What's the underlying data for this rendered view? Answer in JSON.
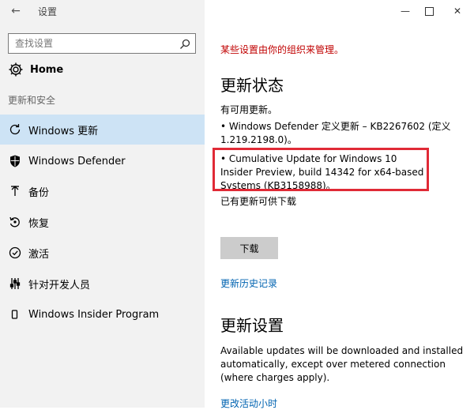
{
  "window": {
    "title": "设置",
    "back_glyph": "←",
    "minimize_glyph": "—",
    "close_glyph": "✕"
  },
  "search": {
    "placeholder": "查找设置"
  },
  "home": {
    "label": "Home"
  },
  "sidebar": {
    "section_label": "更新和安全",
    "items": [
      {
        "label": "Windows 更新",
        "icon": "refresh-icon",
        "active": true
      },
      {
        "label": "Windows Defender",
        "icon": "shield-icon",
        "active": false
      },
      {
        "label": "备份",
        "icon": "backup-arrow-icon",
        "active": false
      },
      {
        "label": "恢复",
        "icon": "recovery-icon",
        "active": false
      },
      {
        "label": "激活",
        "icon": "check-circle-icon",
        "active": false
      },
      {
        "label": "针对开发人员",
        "icon": "developer-sliders-icon",
        "active": false
      },
      {
        "label": "Windows Insider Program",
        "icon": "insider-icon",
        "active": false
      }
    ]
  },
  "main": {
    "managed_notice": "某些设置由你的组织来管理。",
    "update_status_heading": "更新状态",
    "available_text": "有可用更新。",
    "updates": [
      "• Windows Defender 定义更新 – KB2267602 (定义 1.219.2198.0)。",
      "• Cumulative Update for Windows 10 Insider Preview, build 14342 for x64-based Systems (KB3158988)。"
    ],
    "pending_text": "已有更新可供下载",
    "download_label": "下载",
    "history_link": "更新历史记录",
    "update_settings_heading": "更新设置",
    "settings_description": "Available updates will be downloaded and installed automatically, except over metered connection (where charges apply).",
    "active_hours_link": "更改活动小时"
  },
  "colors": {
    "managed_red": "#c00000",
    "link_blue": "#0063b1",
    "active_item_bg": "#cde3f5",
    "highlight_red": "#e02a36"
  }
}
